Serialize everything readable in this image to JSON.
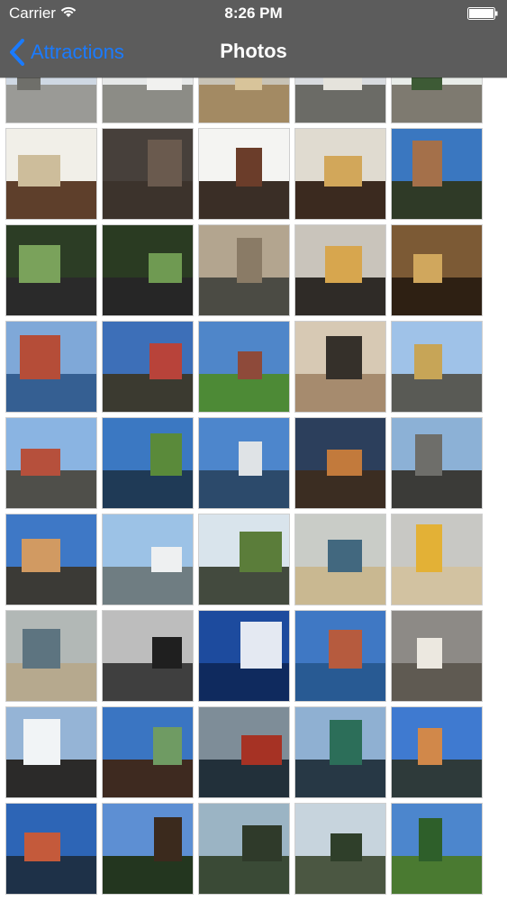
{
  "status_bar": {
    "carrier": "Carrier",
    "time": "8:26 PM"
  },
  "nav_bar": {
    "back_label": "Attractions",
    "title": "Photos",
    "bar_color": "#5c5c5c",
    "accent_color": "#1a7bff"
  },
  "icons": {
    "wifi": "wifi-icon",
    "battery": "battery-icon",
    "back": "chevron-left-icon"
  },
  "grid": {
    "columns": 5,
    "photos": [
      {
        "name": "church-tower-top",
        "sky": "#cfd8e3",
        "ground": "#9a9a96",
        "accent": "#6f6f6a"
      },
      {
        "name": "neoclassical-building",
        "sky": "#e6e8e8",
        "ground": "#8c8c86",
        "accent": "#f1f1ef"
      },
      {
        "name": "domed-building",
        "sky": "#c8c3b6",
        "ground": "#a38a63",
        "accent": "#d8c49a"
      },
      {
        "name": "marble-church-facade",
        "sky": "#d8dbdf",
        "ground": "#6b6b66",
        "accent": "#e5e3dc"
      },
      {
        "name": "old-brick-facade",
        "sky": "#e8ece8",
        "ground": "#7e7a70",
        "accent": "#3d5a35"
      },
      {
        "name": "white-church-interior",
        "sky": "#f1efe8",
        "ground": "#5e3f2b",
        "accent": "#cdbd9b"
      },
      {
        "name": "dark-interior-ceiling",
        "sky": "#47403b",
        "ground": "#3c332c",
        "accent": "#6a5a4e"
      },
      {
        "name": "brick-church-street",
        "sky": "#f4f4f2",
        "ground": "#3a2e26",
        "accent": "#6b3d2a"
      },
      {
        "name": "chandelier-hall",
        "sky": "#e0dbd0",
        "ground": "#3b2a1f",
        "accent": "#d2a75a"
      },
      {
        "name": "green-spire-blue-sky",
        "sky": "#3a77c0",
        "ground": "#2f3a27",
        "accent": "#a4704a"
      },
      {
        "name": "night-trees-street",
        "sky": "#2c3d25",
        "ground": "#2a2a2a",
        "accent": "#7aa25b"
      },
      {
        "name": "night-trees-street-2",
        "sky": "#2a3b22",
        "ground": "#262626",
        "accent": "#6f9a52"
      },
      {
        "name": "ornamental-iron-bridge",
        "sky": "#b3a58f",
        "ground": "#4b4b44",
        "accent": "#8a7b66"
      },
      {
        "name": "ornate-gallery-interior",
        "sky": "#c9c4bb",
        "ground": "#2f2b27",
        "accent": "#d7a64e"
      },
      {
        "name": "golden-church-nave",
        "sky": "#7c5a35",
        "ground": "#2e2013",
        "accent": "#d0a75d"
      },
      {
        "name": "harbour-waterfront",
        "sky": "#7fa8d8",
        "ground": "#355f92",
        "accent": "#b54d38"
      },
      {
        "name": "colourful-canal-houses",
        "sky": "#3d6fb8",
        "ground": "#3b3a30",
        "accent": "#b8433a"
      },
      {
        "name": "park-and-palace",
        "sky": "#4f86c9",
        "ground": "#4d8a36",
        "accent": "#8e4a3a"
      },
      {
        "name": "pedestrian-street",
        "sky": "#d7c9b4",
        "ground": "#a68b6e",
        "accent": "#35302a"
      },
      {
        "name": "cyclist-old-houses",
        "sky": "#9fc2e8",
        "ground": "#595a55",
        "accent": "#c7a557"
      },
      {
        "name": "cyclists-street",
        "sky": "#8ab4e2",
        "ground": "#4f4f4a",
        "accent": "#b6503c"
      },
      {
        "name": "boats-by-trees",
        "sky": "#3b78c2",
        "ground": "#1f3a56",
        "accent": "#5a8a3a"
      },
      {
        "name": "marina-harbour",
        "sky": "#4d86cc",
        "ground": "#2c4a6b",
        "accent": "#dfe3e6"
      },
      {
        "name": "warehouse-canal",
        "sky": "#2c3f5c",
        "ground": "#3b2d22",
        "accent": "#c27a3c"
      },
      {
        "name": "modern-library-steps",
        "sky": "#8cb1d6",
        "ground": "#3b3b38",
        "accent": "#6e6e6a"
      },
      {
        "name": "curved-tower-building",
        "sky": "#3e78c6",
        "ground": "#3b3a36",
        "accent": "#d19a62"
      },
      {
        "name": "white-block-towers",
        "sky": "#9cc2e6",
        "ground": "#6f7d82",
        "accent": "#eef0f1"
      },
      {
        "name": "tree-by-lake",
        "sky": "#d9e4ec",
        "ground": "#434a3e",
        "accent": "#5b7d3a"
      },
      {
        "name": "lifeguard-tower-beach",
        "sky": "#c9ccc7",
        "ground": "#c9b891",
        "accent": "#42687f"
      },
      {
        "name": "beach-flag",
        "sky": "#c8c8c4",
        "ground": "#d2c2a1",
        "accent": "#e3b136"
      },
      {
        "name": "sea-horizon",
        "sky": "#b2b8b6",
        "ground": "#b6a98e",
        "accent": "#5d7480"
      },
      {
        "name": "black-white-pier",
        "sky": "#bdbdbd",
        "ground": "#3f3f3f",
        "accent": "#1f1f1f"
      },
      {
        "name": "glass-reflection-clouds",
        "sky": "#1d4b9e",
        "ground": "#0f2a5e",
        "accent": "#e4e9f2"
      },
      {
        "name": "red-building-waterfront",
        "sky": "#3f78c4",
        "ground": "#285a93",
        "accent": "#b65b3e"
      },
      {
        "name": "beach-house",
        "sky": "#8d8a86",
        "ground": "#5f5a52",
        "accent": "#ece8e0"
      },
      {
        "name": "harbour-bridge-clouds",
        "sky": "#95b4d6",
        "ground": "#2b2a29",
        "accent": "#f1f4f6"
      },
      {
        "name": "green-spire-church",
        "sky": "#3a75c2",
        "ground": "#3e2a20",
        "accent": "#6f9b63"
      },
      {
        "name": "canal-boat",
        "sky": "#7e8d98",
        "ground": "#22303a",
        "accent": "#a63224"
      },
      {
        "name": "canal-with-boats",
        "sky": "#8fb0d2",
        "ground": "#273845",
        "accent": "#2c6e59"
      },
      {
        "name": "colourful-quay-crowd",
        "sky": "#3f7ad0",
        "ground": "#2e3a3a",
        "accent": "#d1884a"
      },
      {
        "name": "canal-houses-boats",
        "sky": "#2d65b6",
        "ground": "#1e3148",
        "accent": "#c45a3b"
      },
      {
        "name": "tree-avenue-silhouette",
        "sky": "#5d8fd3",
        "ground": "#23361f",
        "accent": "#3b2a1d"
      },
      {
        "name": "pond-trees-reflection",
        "sky": "#9bb4c4",
        "ground": "#3a4a36",
        "accent": "#2f3a2a"
      },
      {
        "name": "lake-trees-reflection",
        "sky": "#c7d4dd",
        "ground": "#4b5742",
        "accent": "#2f3f2a"
      },
      {
        "name": "park-trees-bench",
        "sky": "#4c86cd",
        "ground": "#4a7a31",
        "accent": "#2e5f2a"
      }
    ]
  }
}
